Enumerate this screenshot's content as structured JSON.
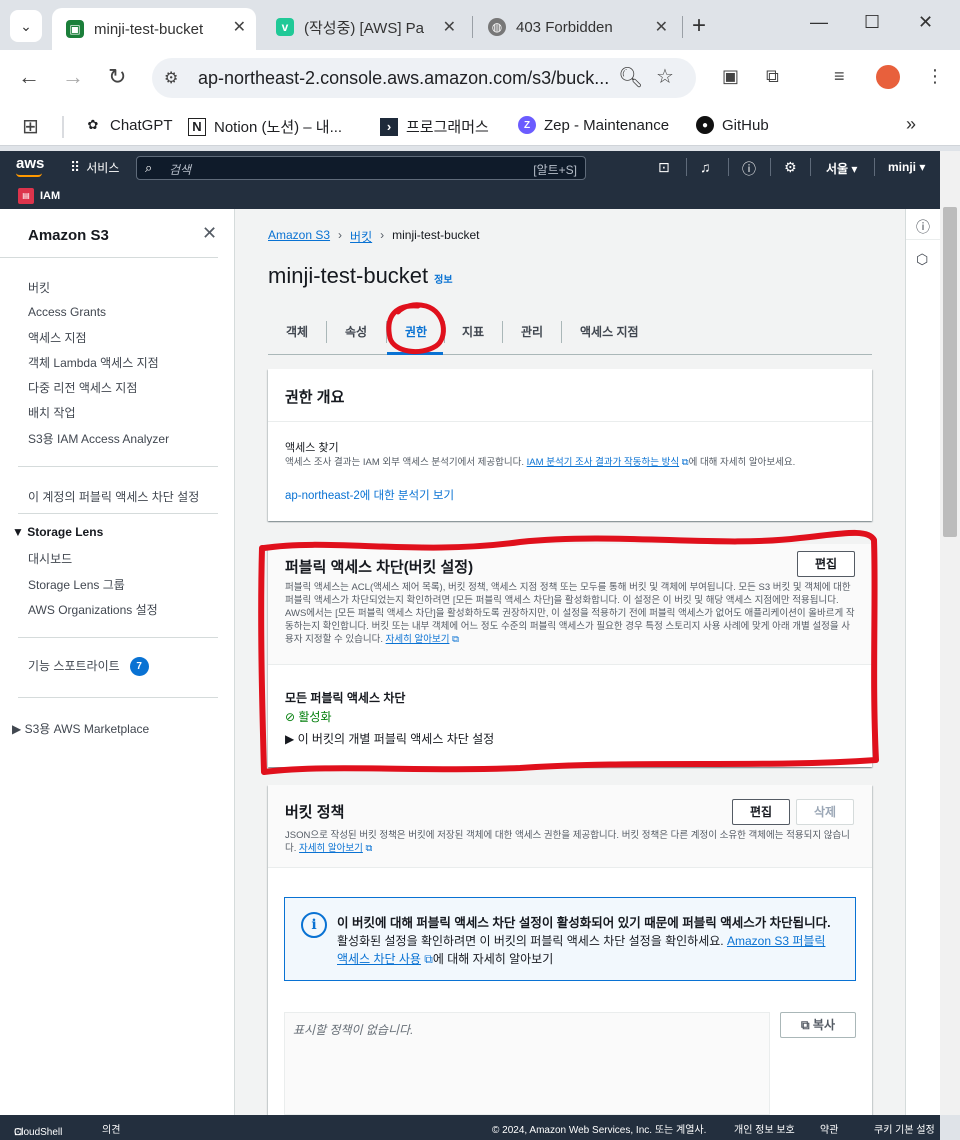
{
  "browser": {
    "tabs": [
      {
        "title": "minji-test-bucket",
        "active": true,
        "favicon_color": "#1b7f3a"
      },
      {
        "title": "(작성중) [AWS] Pa",
        "active": false,
        "favicon_color": "#20c997"
      },
      {
        "title": "403 Forbidden",
        "active": false,
        "favicon_color": "#666666"
      }
    ],
    "url": "ap-northeast-2.console.aws.amazon.com/s3/buck...",
    "bookmarks": [
      "ChatGPT",
      "Notion (노션) – 내...",
      "프로그래머스",
      "Zep - Maintenance",
      "GitHub"
    ]
  },
  "aws": {
    "logo": "aws",
    "services_label": "서비스",
    "search_placeholder": "검색",
    "search_shortcut": "[알트+S]",
    "region": "서울 ▾",
    "user": "minji ▾",
    "favorite": "IAM"
  },
  "sidebar": {
    "title": "Amazon S3",
    "items1": [
      "버킷",
      "Access Grants",
      "액세스 지점",
      "객체 Lambda 액세스 지점",
      "다중 리전 액세스 지점",
      "배치 작업",
      "S3용 IAM Access Analyzer"
    ],
    "block_settings": "이 계정의 퍼블릭 액세스 차단 설정",
    "storage_lens": "Storage Lens",
    "items2": [
      "대시보드",
      "Storage Lens 그룹",
      "AWS Organizations 설정"
    ],
    "feature_spotlight": "기능 스포트라이트",
    "feature_count": "7",
    "marketplace": "S3용 AWS Marketplace"
  },
  "breadcrumb": {
    "root": "Amazon S3",
    "buckets": "버킷",
    "current": "minji-test-bucket"
  },
  "page_title": "minji-test-bucket",
  "info_label": "정보",
  "tabs": [
    "객체",
    "속성",
    "권한",
    "지표",
    "관리",
    "액세스 지점"
  ],
  "permissions_overview": {
    "title": "권한 개요",
    "access_finding": "액세스 찾기",
    "desc_pre": "액세스 조사 결과는 IAM 외부 액세스 분석기에서 제공합니다. ",
    "desc_link": "IAM 분석기 조사 결과가 작동하는 방식",
    "desc_post": "에 대해 자세히 알아보세요.",
    "analyzer_link": "ap-northeast-2에 대한 분석기 보기"
  },
  "block_public_access": {
    "title": "퍼블릭 액세스 차단(버킷 설정)",
    "edit": "편집",
    "desc": "퍼블릭 액세스는 ACL(액세스 제어 목록), 버킷 정책, 액세스 지점 정책 또는 모두를 통해 버킷 및 객체에 부여됩니다. 모든 S3 버킷 및 객체에 대한 퍼블릭 액세스가 차단되었는지 확인하려면 [모든 퍼블릭 액세스 차단]을 활성화합니다. 이 설정은 이 버킷 및 해당 액세스 지점에만 적용됩니다. AWS에서는 [모든 퍼블릭 액세스 차단]을 활성화하도록 권장하지만, 이 설정을 적용하기 전에 퍼블릭 액세스가 없어도 애플리케이션이 올바르게 작동하는지 확인합니다. 버킷 또는 내부 객체에 어느 정도 수준의 퍼블릭 액세스가 필요한 경우 특정 스토리지 사용 사례에 맞게 아래 개별 설정을 사용자 지정할 수 있습니다. ",
    "learn_more": "자세히 알아보기",
    "all_label": "모든 퍼블릭 액세스 차단",
    "status": "활성화",
    "expand": "이 버킷의 개별 퍼블릭 액세스 차단 설정"
  },
  "bucket_policy": {
    "title": "버킷 정책",
    "edit": "편집",
    "delete": "삭제",
    "desc": "JSON으로 작성된 버킷 정책은 버킷에 저장된 객체에 대한 액세스 권한을 제공합니다. 버킷 정책은 다른 계정이 소유한 객체에는 적용되지 않습니다. ",
    "learn_more": "자세히 알아보기",
    "alert_title": "이 버킷에 대해 퍼블릭 액세스 차단 설정이 활성화되어 있기 때문에 퍼블릭 액세스가 차단됩니다.",
    "alert_body": "활성화된 설정을 확인하려면 이 버킷의 퍼블릭 액세스 차단 설정을 확인하세요. ",
    "alert_link": "Amazon S3 퍼블릭 액세스 차단 사용",
    "alert_post": "에 대해 자세히 알아보기",
    "empty": "표시할 정책이 없습니다.",
    "copy": "복사"
  },
  "footer": {
    "cloudshell": "CloudShell",
    "feedback": "의견",
    "copyright": "© 2024, Amazon Web Services, Inc. 또는 계열사.",
    "privacy": "개인 정보 보호",
    "terms": "약관",
    "cookies": "쿠키 기본 설정"
  },
  "colors": {
    "link": "#0972d3",
    "annotation": "#e0101c",
    "success": "#037f0c",
    "aws_nav": "#232f3e"
  }
}
